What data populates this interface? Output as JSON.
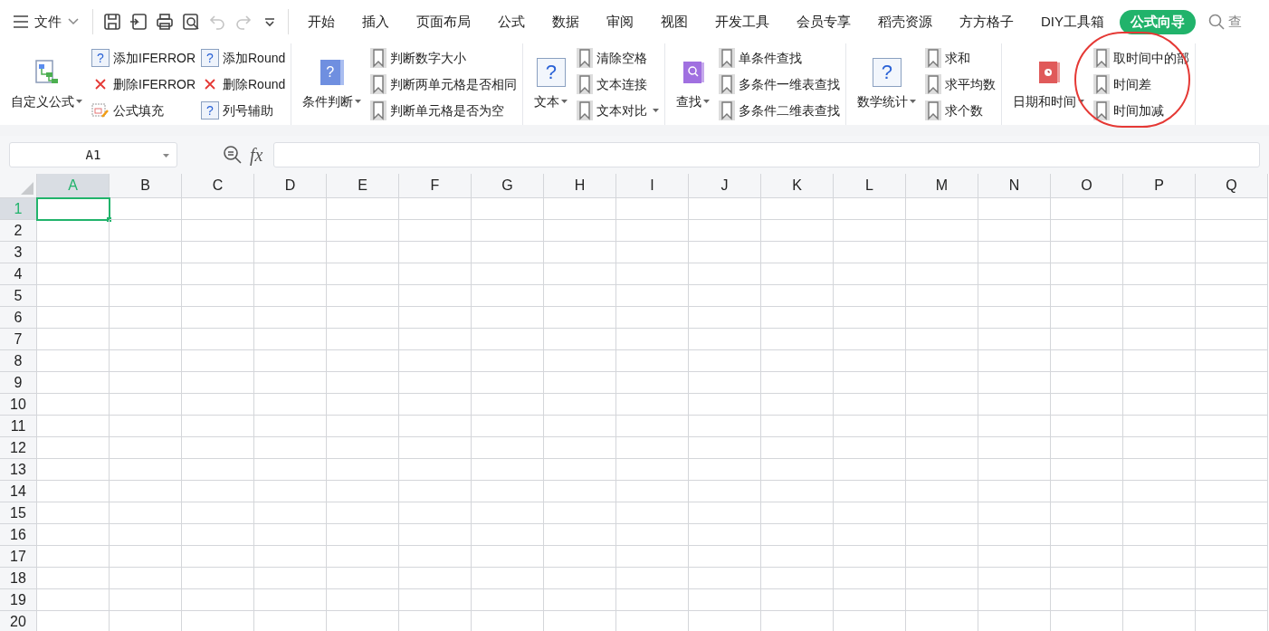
{
  "quick_bar": {
    "file_menu": "文件",
    "tools": [
      {
        "kind": "save",
        "disabled": false
      },
      {
        "kind": "export",
        "disabled": false
      },
      {
        "kind": "print",
        "disabled": false
      },
      {
        "kind": "preview",
        "disabled": false
      },
      {
        "kind": "undo",
        "disabled": true
      },
      {
        "kind": "redo",
        "disabled": true
      },
      {
        "kind": "more",
        "disabled": false
      }
    ]
  },
  "tabs": [
    {
      "label": "开始",
      "selected": false
    },
    {
      "label": "插入",
      "selected": false
    },
    {
      "label": "页面布局",
      "selected": false
    },
    {
      "label": "公式",
      "selected": false
    },
    {
      "label": "数据",
      "selected": false
    },
    {
      "label": "审阅",
      "selected": false
    },
    {
      "label": "视图",
      "selected": false
    },
    {
      "label": "开发工具",
      "selected": false
    },
    {
      "label": "会员专享",
      "selected": false
    },
    {
      "label": "稻壳资源",
      "selected": false
    },
    {
      "label": "方方格子",
      "selected": false
    },
    {
      "label": "DIY工具箱",
      "selected": false
    },
    {
      "label": "公式向导",
      "selected": true
    }
  ],
  "search": {
    "label": "查"
  },
  "ribbon": {
    "groups": [
      {
        "big": {
          "label": "自定义公式",
          "kind": "tree",
          "dropdown": true
        },
        "columns": [
          [
            {
              "label": "添加IFERROR",
              "kind": "question",
              "glyph": "?"
            },
            {
              "label": "删除IFERROR",
              "kind": "cross"
            },
            {
              "label": "公式填充",
              "kind": "fill"
            }
          ],
          [
            {
              "label": "添加Round",
              "kind": "question",
              "glyph": "?"
            },
            {
              "label": "删除Round",
              "kind": "cross"
            },
            {
              "label": "列号辅助",
              "kind": "question",
              "glyph": "?"
            }
          ]
        ]
      },
      {
        "big": {
          "label": "条件判断",
          "kind": "book-question",
          "glyph": "?",
          "dropdown": true
        },
        "columns": [
          [
            {
              "label": "判断数字大小",
              "kind": "bookmark"
            },
            {
              "label": "判断两单元格是否相同",
              "kind": "bookmark"
            },
            {
              "label": "判断单元格是否为空",
              "kind": "bookmark"
            }
          ]
        ]
      },
      {
        "big": {
          "label": "文本",
          "kind": "question",
          "glyph": "?",
          "dropdown": true
        },
        "columns": [
          [
            {
              "label": "清除空格",
              "kind": "bookmark"
            },
            {
              "label": "文本连接",
              "kind": "bookmark"
            },
            {
              "label": "文本对比",
              "kind": "bookmark",
              "dropdown": true
            }
          ]
        ]
      },
      {
        "big": {
          "label": "查找",
          "kind": "book-search",
          "dropdown": true
        },
        "columns": [
          [
            {
              "label": "单条件查找",
              "kind": "bookmark"
            },
            {
              "label": "多条件一维表查找",
              "kind": "bookmark"
            },
            {
              "label": "多条件二维表查找",
              "kind": "bookmark"
            }
          ]
        ]
      },
      {
        "big": {
          "label": "数学统计",
          "kind": "question",
          "glyph": "?",
          "dropdown": true
        },
        "columns": [
          [
            {
              "label": "求和",
              "kind": "bookmark"
            },
            {
              "label": "求平均数",
              "kind": "bookmark"
            },
            {
              "label": "求个数",
              "kind": "bookmark"
            }
          ]
        ]
      },
      {
        "big": {
          "label": "日期和时间",
          "kind": "book-clock",
          "dropdown": true
        },
        "columns": [
          [
            {
              "label": "取时间中的部",
              "kind": "bookmark"
            },
            {
              "label": "时间差",
              "kind": "bookmark"
            },
            {
              "label": "时间加减",
              "kind": "bookmark"
            }
          ]
        ]
      }
    ]
  },
  "name_box": {
    "value": "A1"
  },
  "formula_bar": {
    "fx": "fx"
  },
  "sheet": {
    "columns": [
      {
        "label": "A",
        "selected": true
      },
      {
        "label": "B",
        "selected": false
      },
      {
        "label": "C",
        "selected": false
      },
      {
        "label": "D",
        "selected": false
      },
      {
        "label": "E",
        "selected": false
      },
      {
        "label": "F",
        "selected": false
      },
      {
        "label": "G",
        "selected": false
      },
      {
        "label": "H",
        "selected": false
      },
      {
        "label": "I",
        "selected": false
      },
      {
        "label": "J",
        "selected": false
      },
      {
        "label": "K",
        "selected": false
      },
      {
        "label": "L",
        "selected": false
      },
      {
        "label": "M",
        "selected": false
      },
      {
        "label": "N",
        "selected": false
      },
      {
        "label": "O",
        "selected": false
      },
      {
        "label": "P",
        "selected": false
      },
      {
        "label": "Q",
        "selected": false
      }
    ],
    "rows": [
      {
        "label": "1",
        "selected": true
      },
      {
        "label": "2",
        "selected": false
      },
      {
        "label": "3",
        "selected": false
      },
      {
        "label": "4",
        "selected": false
      },
      {
        "label": "5",
        "selected": false
      },
      {
        "label": "6",
        "selected": false
      },
      {
        "label": "7",
        "selected": false
      },
      {
        "label": "8",
        "selected": false
      },
      {
        "label": "9",
        "selected": false
      },
      {
        "label": "10",
        "selected": false
      },
      {
        "label": "11",
        "selected": false
      },
      {
        "label": "12",
        "selected": false
      },
      {
        "label": "13",
        "selected": false
      },
      {
        "label": "14",
        "selected": false
      },
      {
        "label": "15",
        "selected": false
      },
      {
        "label": "16",
        "selected": false
      },
      {
        "label": "17",
        "selected": false
      },
      {
        "label": "18",
        "selected": false
      },
      {
        "label": "19",
        "selected": false
      },
      {
        "label": "20",
        "selected": false
      }
    ]
  }
}
